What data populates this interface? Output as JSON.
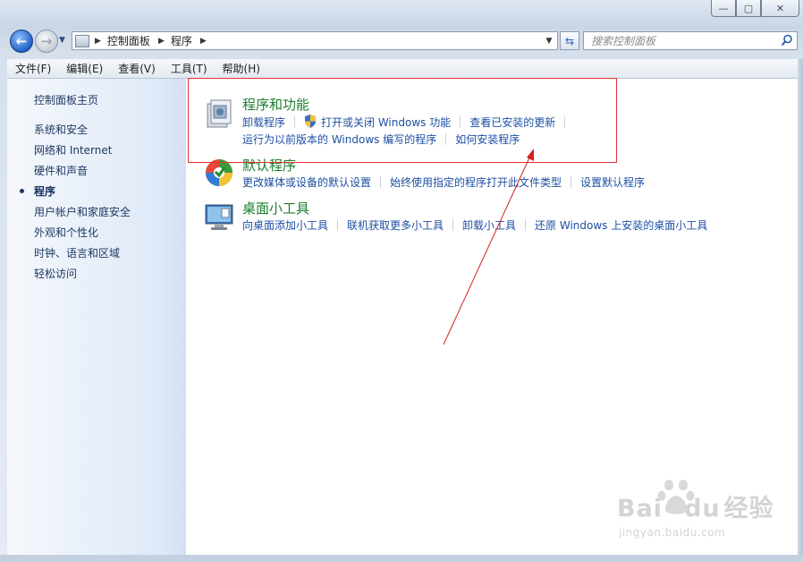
{
  "window": {
    "minimize_label": "—",
    "maximize_label": "▢",
    "close_label": "✕"
  },
  "navbar": {
    "breadcrumb": [
      "控制面板",
      "程序"
    ],
    "search_placeholder": "搜索控制面板"
  },
  "menu": {
    "items": [
      "文件(F)",
      "编辑(E)",
      "查看(V)",
      "工具(T)",
      "帮助(H)"
    ]
  },
  "sidebar": {
    "home": "控制面板主页",
    "items": [
      {
        "label": "系统和安全",
        "active": false
      },
      {
        "label": "网络和 Internet",
        "active": false
      },
      {
        "label": "硬件和声音",
        "active": false
      },
      {
        "label": "程序",
        "active": true
      },
      {
        "label": "用户帐户和家庭安全",
        "active": false
      },
      {
        "label": "外观和个性化",
        "active": false
      },
      {
        "label": "时钟、语言和区域",
        "active": false
      },
      {
        "label": "轻松访问",
        "active": false
      }
    ]
  },
  "categories": [
    {
      "title": "程序和功能",
      "icon": "programs-features-icon",
      "links": [
        [
          "卸载程序",
          "打开或关闭 Windows 功能",
          "查看已安装的更新"
        ],
        [
          "运行为以前版本的 Windows 编写的程序",
          "如何安装程序"
        ]
      ]
    },
    {
      "title": "默认程序",
      "icon": "default-programs-icon",
      "links": [
        [
          "更改媒体或设备的默认设置",
          "始终使用指定的程序打开此文件类型",
          "设置默认程序"
        ]
      ]
    },
    {
      "title": "桌面小工具",
      "icon": "desktop-gadgets-icon",
      "links": [
        [
          "向桌面添加小工具",
          "联机获取更多小工具",
          "卸载小工具",
          "还原 Windows 上安装的桌面小工具"
        ]
      ]
    }
  ],
  "watermark": {
    "logo_left": "Bai",
    "logo_right": "经验",
    "logo_mid": "du",
    "url": "jingyan.baidu.com"
  },
  "colors": {
    "link": "#1d4fa3",
    "category_title": "#1a7f2e",
    "annotation": "#e53030"
  }
}
